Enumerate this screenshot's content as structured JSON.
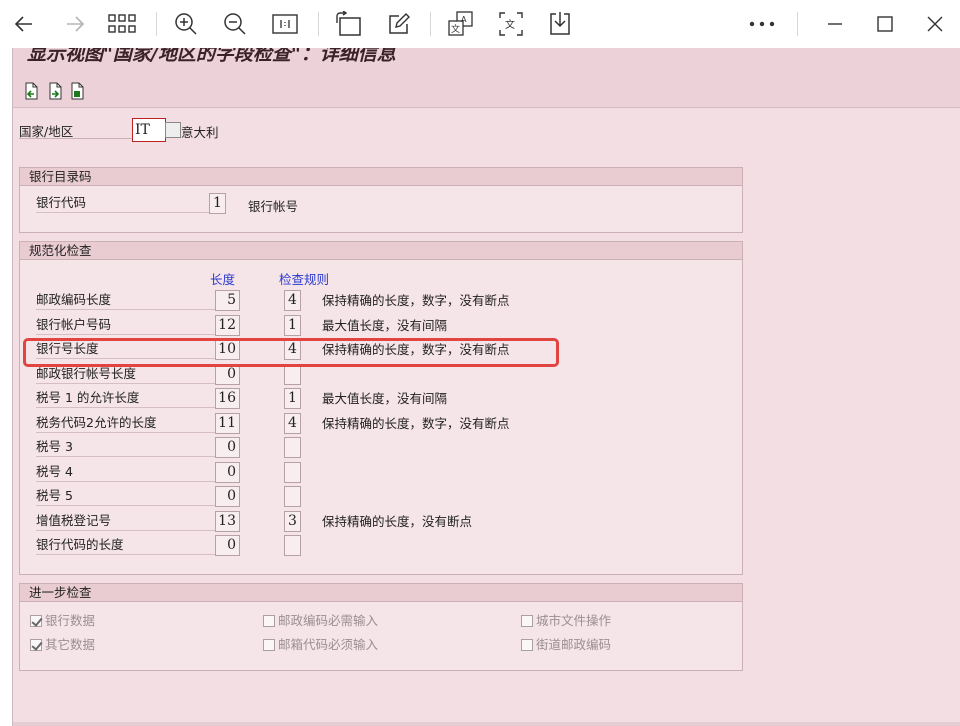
{
  "viewer": {
    "icons": [
      "back-arrow-icon",
      "forward-arrow-icon",
      "grid-view-icon",
      "zoom-in-icon",
      "zoom-out-icon",
      "fit-page-icon",
      "rotate-icon",
      "edit-icon",
      "translate-icon",
      "text-recognize-icon",
      "download-icon",
      "more-icon",
      "minimize-icon",
      "maximize-icon",
      "close-icon"
    ]
  },
  "sap": {
    "title": "显示视图\"国家/地区的字段检查\"：详细信息",
    "country_label": "国家/地区",
    "country_value": "IT",
    "country_name": "意大利",
    "bank_dir": {
      "title": "银行目录码",
      "bank_code_label": "银行代码",
      "bank_code_value": "1",
      "bank_code_text": "银行帐号"
    },
    "format_check": {
      "title": "规范化检查",
      "col_length": "长度",
      "col_rule": "检查规则",
      "rows": [
        {
          "label": "邮政编码长度",
          "length": "5",
          "rule": "4",
          "desc": "保持精确的长度，数字，没有断点"
        },
        {
          "label": "银行帐户号码",
          "length": "12",
          "rule": "1",
          "desc": "最大值长度，没有间隔"
        },
        {
          "label": "银行号长度",
          "length": "10",
          "rule": "4",
          "desc": "保持精确的长度，数字，没有断点"
        },
        {
          "label": "邮政银行帐号长度",
          "length": "0",
          "rule": "",
          "desc": ""
        },
        {
          "label": "税号 1 的允许长度",
          "length": "16",
          "rule": "1",
          "desc": "最大值长度，没有间隔"
        },
        {
          "label": "税务代码2允许的长度",
          "length": "11",
          "rule": "4",
          "desc": "保持精确的长度，数字，没有断点"
        },
        {
          "label": "税号 3",
          "length": "0",
          "rule": "",
          "desc": ""
        },
        {
          "label": "税号 4",
          "length": "0",
          "rule": "",
          "desc": ""
        },
        {
          "label": "税号 5",
          "length": "0",
          "rule": "",
          "desc": ""
        },
        {
          "label": "增值税登记号",
          "length": "13",
          "rule": "3",
          "desc": "保持精确的长度，没有断点"
        },
        {
          "label": "银行代码的长度",
          "length": "0",
          "rule": "",
          "desc": ""
        }
      ]
    },
    "further_check": {
      "title": "进一步检查",
      "bank_data": "银行数据",
      "postcode_required": "邮政编码必需输入",
      "city_file": "城市文件操作",
      "other_data": "其它数据",
      "pobox_required": "邮箱代码必须输入",
      "street_postcode": "街道邮政编码"
    }
  }
}
